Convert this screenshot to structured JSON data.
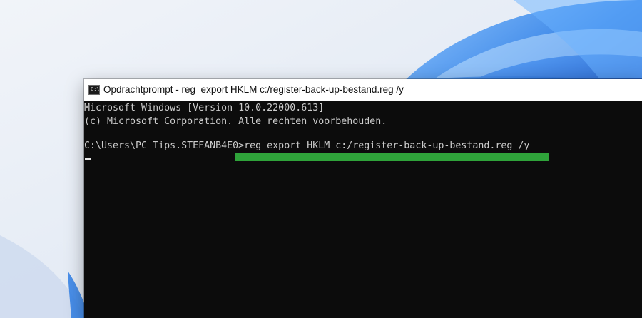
{
  "window": {
    "title": "Opdrachtprompt - reg  export HKLM c:/register-back-up-bestand.reg /y",
    "icon": "cmd-icon",
    "icon_label": "C:\\."
  },
  "console": {
    "lines": [
      "Microsoft Windows [Version 10.0.22000.613]",
      "(c) Microsoft Corporation. Alle rechten voorbehouden.",
      "C:\\Users\\PC Tips.STEFANB4E0>reg export HKLM c:/register-back-up-bestand.reg /y"
    ]
  },
  "colors": {
    "console_background": "#0c0c0c",
    "console_text": "#cccccc",
    "highlight": "#2fa33a",
    "title_bar": "#ffffff"
  }
}
